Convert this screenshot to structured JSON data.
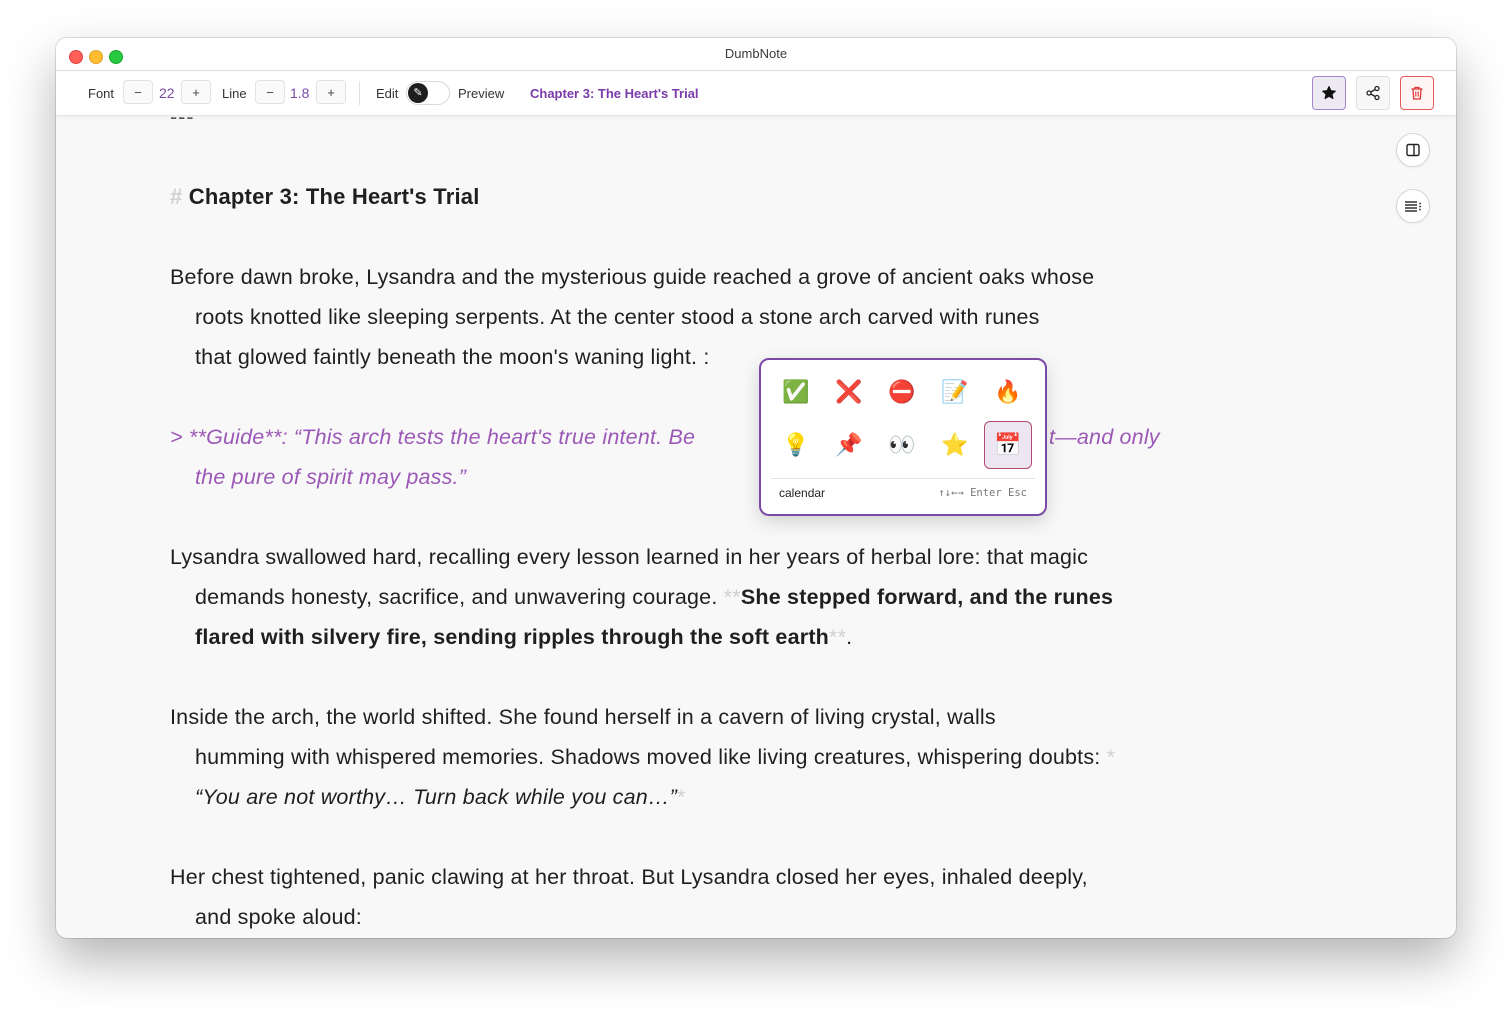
{
  "window": {
    "title": "DumbNote"
  },
  "toolbar": {
    "font_label": "Font",
    "font_minus": "−",
    "font_value": "22",
    "font_plus": "+",
    "line_label": "Line",
    "line_minus": "−",
    "line_value": "1.8",
    "line_plus": "+",
    "edit_label": "Edit",
    "preview_label": "Preview",
    "toggle_icon": "✎",
    "doc_title": "Chapter 3: The Heart's Trial",
    "icons": [
      "star-icon",
      "share-icon",
      "trash-icon"
    ]
  },
  "side_buttons": {
    "icons": [
      "split-view-icon",
      "outline-icon"
    ]
  },
  "editor": {
    "hr": "---",
    "heading_marker": "#",
    "heading_text": "Chapter 3: The Heart's Trial",
    "p1": [
      "Before dawn broke, Lysandra and the mysterious guide reached a grove of ancient oaks whose",
      "roots knotted like sleeping serpents. At the center stood a stone arch carved with runes",
      "that glowed faintly beneath the moon's waning light. :"
    ],
    "quote": [
      {
        "left": "> **Guide**: “This arch tests the heart's true intent. Be",
        "right": "t—and only"
      },
      {
        "text": "the pure of spirit may pass.”"
      }
    ],
    "p2": {
      "line1": "Lysandra swallowed hard, recalling every lesson learned in her years of herbal lore: that magic",
      "line2_plain": "demands honesty, sacrifice, and unwavering courage. ",
      "marker_open": "**",
      "line2_bold": "She stepped forward, and the runes",
      "line3_bold": "flared with silvery fire, sending ripples through the soft earth",
      "marker_close": "**",
      "line3_end": "."
    },
    "p3": {
      "line1": "Inside the arch, the world shifted. She found herself in a cavern of living crystal, walls",
      "line2": "humming with whispered memories. Shadows moved like living creatures, whispering doubts: ",
      "marker": "*",
      "line3_italic": "“You are not worthy… Turn back while you can…”",
      "marker_close": "*"
    },
    "p4": [
      "Her chest tightened, panic clawing at her throat. But Lysandra closed her eyes, inhaled deeply,",
      "and spoke aloud:"
    ]
  },
  "emoji_picker": {
    "emojis": [
      "✅",
      "❌",
      "⛔",
      "📝",
      "🔥",
      "💡",
      "📌",
      "👀",
      "⭐",
      "📅"
    ],
    "emoji_names": [
      "check-mark-icon",
      "cross-mark-icon",
      "no-entry-icon",
      "memo-icon",
      "fire-icon",
      "light-bulb-icon",
      "pushpin-icon",
      "eyes-icon",
      "star-icon",
      "calendar-icon"
    ],
    "selected_name": "calendar",
    "hint": "↑↓←→ Enter Esc"
  }
}
